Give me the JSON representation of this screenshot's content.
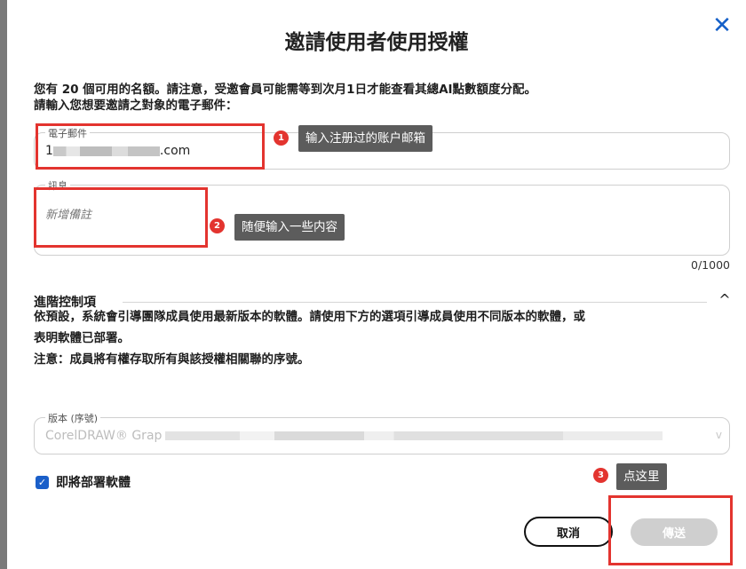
{
  "dialog": {
    "title": "邀請使用者使用授權",
    "close_icon": "✕",
    "intro_line1": "您有 20 個可用的名額。請注意，受邀會員可能需等到次月1日才能查看其總AI點數額度分配。",
    "intro_line2": "請輸入您想要邀請之對象的電子郵件："
  },
  "email": {
    "legend": "電子郵件",
    "value_visible": "1",
    "value_suffix": ".com"
  },
  "message": {
    "legend": "訊息",
    "placeholder": "新增備註",
    "counter": "0/1000"
  },
  "advanced": {
    "title": "進階控制項",
    "chevron": "^",
    "desc_line1": "依預設，系統會引導團隊成員使用最新版本的軟體。請使用下方的選項引導成員使用不同版本的軟體，或",
    "desc_line2": "表明軟體已部署。",
    "desc_line3": "注意：成員將有權存取所有與該授權相關聯的序號。"
  },
  "version": {
    "legend": "版本 (序號)",
    "value_prefix": "CorelDRAW® Grap",
    "chevron": "v"
  },
  "deploy": {
    "checked": true,
    "check_glyph": "✓",
    "label": "即將部署軟體"
  },
  "buttons": {
    "cancel": "取消",
    "send": "傳送"
  },
  "annotations": [
    {
      "num": "1",
      "text": "输入注册过的账户邮箱"
    },
    {
      "num": "2",
      "text": "随便输入一些内容"
    },
    {
      "num": "3",
      "text": "点这里"
    }
  ],
  "colors": {
    "accent": "#1a5fc9",
    "annotation_red": "#e3342f",
    "send_disabled": "#cfcfcf"
  }
}
